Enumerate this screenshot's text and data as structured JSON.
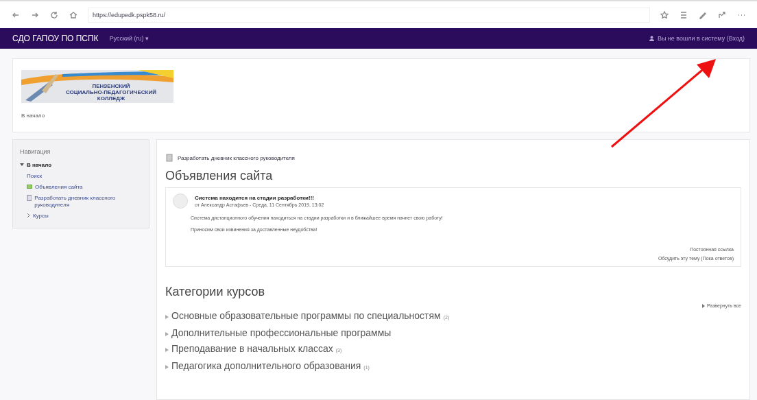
{
  "browser": {
    "url": "https://edupedk.pspk58.ru/"
  },
  "navbar": {
    "brand": "СДО ГАПОУ ПО ПСПК",
    "language": "Русский (ru) ▾",
    "login": "Вы не вошли в систему (Вход)"
  },
  "header": {
    "logo_lines": [
      "ПЕНЗЕНСКИЙ",
      "СОЦИАЛЬНО-ПЕДАГОГИЧЕСКИЙ",
      "КОЛЛЕДЖ"
    ],
    "breadcrumb": "В начало"
  },
  "navigation": {
    "title": "Навигация",
    "items": [
      {
        "label": "В начало",
        "kind": "root",
        "expanded": true,
        "children": [
          {
            "label": "Поиск",
            "kind": "plain"
          },
          {
            "label": "Объявления сайта",
            "kind": "forum"
          },
          {
            "label": "Разработать дневник классного руководителя",
            "kind": "assignment"
          },
          {
            "label": "Курсы",
            "kind": "branch"
          }
        ]
      }
    ]
  },
  "main": {
    "activity": "Разработать дневник классного руководителя",
    "news_title": "Объявления сайта",
    "post": {
      "subject": "Система находится на стадии разработки!!!",
      "byline": "от Александр Астафьев - Среда, 11 Сентябрь 2019, 13:02",
      "paragraphs": [
        "Система дистанционного обучения находиться на стадии разработки и в ближайшее время начнет свою работу!",
        "Приносим свои извинения за доставленные неудобства!"
      ],
      "links": [
        "Постоянная ссылка",
        "Обсудить эту тему (Пока ответов)"
      ]
    },
    "categories_title": "Категории курсов",
    "expand_all": "Развернуть все",
    "categories": [
      {
        "name": "Основные образовательные программы по специальностям",
        "count": "(2)"
      },
      {
        "name": "Дополнительные профессиональные программы"
      },
      {
        "name": "Преподавание в начальных классах",
        "count": "(3)"
      },
      {
        "name": "Педагогика дополнительного образования",
        "count": "(1)"
      }
    ]
  }
}
